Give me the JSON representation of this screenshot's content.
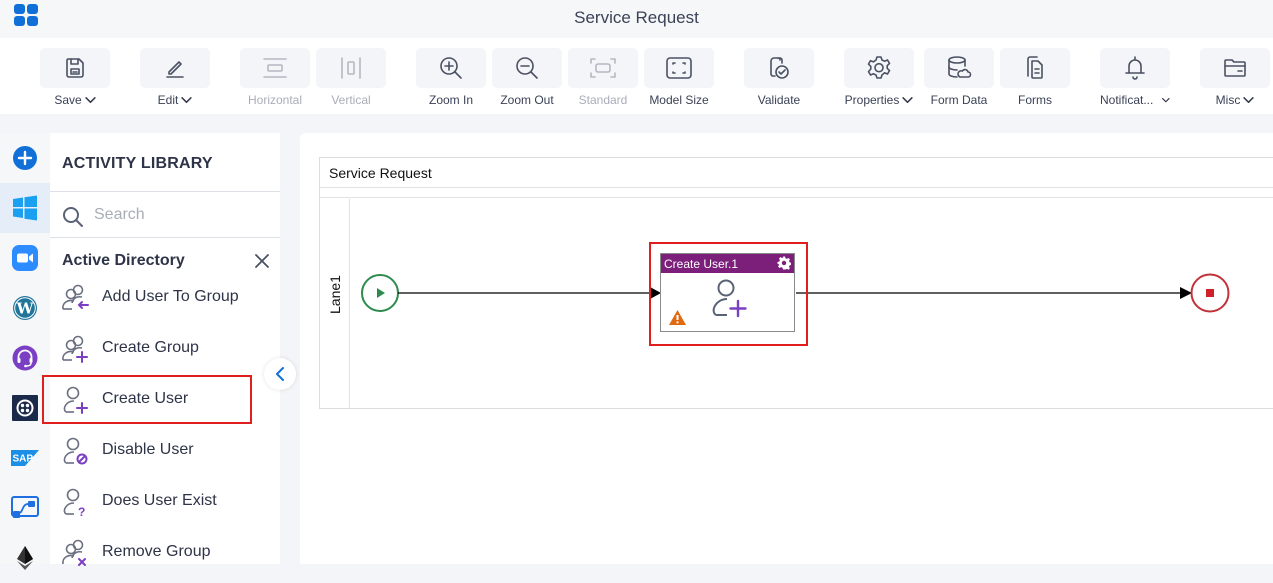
{
  "app": {
    "title": "Service Request",
    "app_menu_icon": "app-grid-icon"
  },
  "toolbar": {
    "buttons": [
      {
        "id": "save",
        "label": "Save",
        "icon": "save-icon",
        "has_dropdown": true,
        "enabled": true
      },
      {
        "id": "edit",
        "label": "Edit",
        "icon": "pencil-icon",
        "has_dropdown": true,
        "enabled": true
      },
      {
        "id": "horizontal",
        "label": "Horizontal",
        "icon": "horizontal-align-icon",
        "has_dropdown": false,
        "enabled": false
      },
      {
        "id": "vertical",
        "label": "Vertical",
        "icon": "vertical-align-icon",
        "has_dropdown": false,
        "enabled": false
      },
      {
        "id": "zoom-in",
        "label": "Zoom In",
        "icon": "zoom-in-icon",
        "has_dropdown": false,
        "enabled": true
      },
      {
        "id": "zoom-out",
        "label": "Zoom Out",
        "icon": "zoom-out-icon",
        "has_dropdown": false,
        "enabled": true
      },
      {
        "id": "standard",
        "label": "Standard",
        "icon": "standard-size-icon",
        "has_dropdown": false,
        "enabled": false
      },
      {
        "id": "model-size",
        "label": "Model Size",
        "icon": "fit-to-screen-icon",
        "has_dropdown": false,
        "enabled": true
      },
      {
        "id": "validate",
        "label": "Validate",
        "icon": "validate-icon",
        "has_dropdown": false,
        "enabled": true
      },
      {
        "id": "properties",
        "label": "Properties",
        "icon": "gear-icon",
        "has_dropdown": true,
        "enabled": true
      },
      {
        "id": "form-data",
        "label": "Form Data",
        "icon": "database-icon",
        "has_dropdown": false,
        "enabled": true
      },
      {
        "id": "forms",
        "label": "Forms",
        "icon": "forms-icon",
        "has_dropdown": false,
        "enabled": true
      },
      {
        "id": "notifications",
        "label": "Notificat...",
        "icon": "bell-icon",
        "has_dropdown": true,
        "enabled": true
      },
      {
        "id": "misc",
        "label": "Misc",
        "icon": "folder-icon",
        "has_dropdown": true,
        "enabled": true
      }
    ]
  },
  "rail": {
    "items": [
      {
        "name": "add",
        "icon": "add-circle-icon",
        "active": false
      },
      {
        "name": "windows",
        "icon": "windows-icon",
        "active": true
      },
      {
        "name": "zoom",
        "icon": "zoom-video-icon",
        "active": false
      },
      {
        "name": "wordpress",
        "icon": "wordpress-icon",
        "active": false
      },
      {
        "name": "support",
        "icon": "headset-icon",
        "active": false
      },
      {
        "name": "twilio",
        "icon": "twilio-icon",
        "active": false
      },
      {
        "name": "sap",
        "icon": "sap-icon",
        "active": false
      },
      {
        "name": "power-automate",
        "icon": "power-automate-icon",
        "active": false
      },
      {
        "name": "ethereum",
        "icon": "ethereum-icon",
        "active": false
      }
    ],
    "sap_text": "SAP"
  },
  "library": {
    "title": "ACTIVITY LIBRARY",
    "search_placeholder": "Search",
    "search_value": "",
    "section": "Active Directory",
    "items": [
      {
        "label": "Add User To Group",
        "icon": "add-user-to-group-icon"
      },
      {
        "label": "Create Group",
        "icon": "create-group-icon"
      },
      {
        "label": "Create User",
        "icon": "create-user-icon",
        "selected": true
      },
      {
        "label": "Disable User",
        "icon": "disable-user-icon"
      },
      {
        "label": "Does User Exist",
        "icon": "does-user-exist-icon"
      },
      {
        "label": "Remove Group",
        "icon": "remove-group-icon"
      }
    ]
  },
  "canvas": {
    "pool_title": "Service Request",
    "lane_label": "Lane1",
    "task": {
      "name": "Create User.1",
      "has_warning": true
    },
    "colors": {
      "task_header": "#7b1f7b",
      "start_event": "#2e8b4e",
      "end_event": "#c0333a",
      "highlight": "#e01e1e",
      "accent": "#1070d8"
    }
  }
}
